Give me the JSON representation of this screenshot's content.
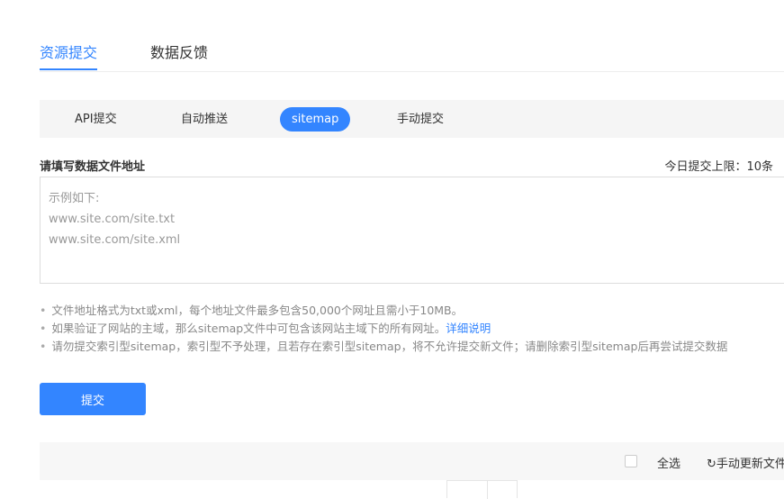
{
  "tabs": [
    {
      "label": "资源提交"
    },
    {
      "label": "数据反馈"
    }
  ],
  "subtabs": [
    {
      "label": "API提交"
    },
    {
      "label": "自动推送"
    },
    {
      "label": "sitemap"
    },
    {
      "label": "手动提交"
    }
  ],
  "form": {
    "label": "请填写数据文件地址",
    "limit": "今日提交上限：10条",
    "placeholder": "示例如下:\nwww.site.com/site.txt\nwww.site.com/site.xml"
  },
  "notes": [
    "文件地址格式为txt或xml，每个地址文件最多包含50,000个网址且需小于10MB。",
    "如果验证了网站的主域，那么sitemap文件中可包含该网站主域下的所有网址。",
    "请勿提交索引型sitemap，索引型不予处理，且若存在索引型sitemap，将不允许提交新文件；请删除索引型sitemap后再尝试提交数据"
  ],
  "note_link": "详细说明",
  "submit": "提交",
  "toolbar": {
    "select_all": "全选",
    "refresh": "手动更新文件"
  }
}
